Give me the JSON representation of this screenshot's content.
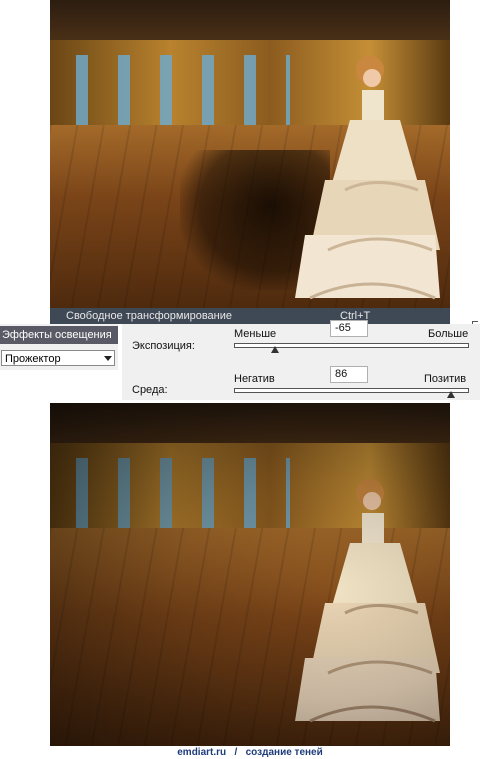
{
  "menu": {
    "item_label": "Свободное трансформирование",
    "shortcut": "Ctrl+T"
  },
  "effects_panel": {
    "title": "Эффекты освещения",
    "style_value": "Прожектор"
  },
  "exposure": {
    "label": "Экспозиция:",
    "min_label": "Меньше",
    "max_label": "Больше",
    "value": "-65"
  },
  "ambience": {
    "label": "Среда:",
    "min_label": "Негатив",
    "max_label": "Позитив",
    "value": "86"
  },
  "footer": {
    "site": "emdiart.ru",
    "separator": "/",
    "caption": "создание теней"
  },
  "colors": {
    "menu_bg": "#3f4855",
    "panel_bg": "#f0f0f0",
    "footer_text": "#1f3c7a"
  }
}
